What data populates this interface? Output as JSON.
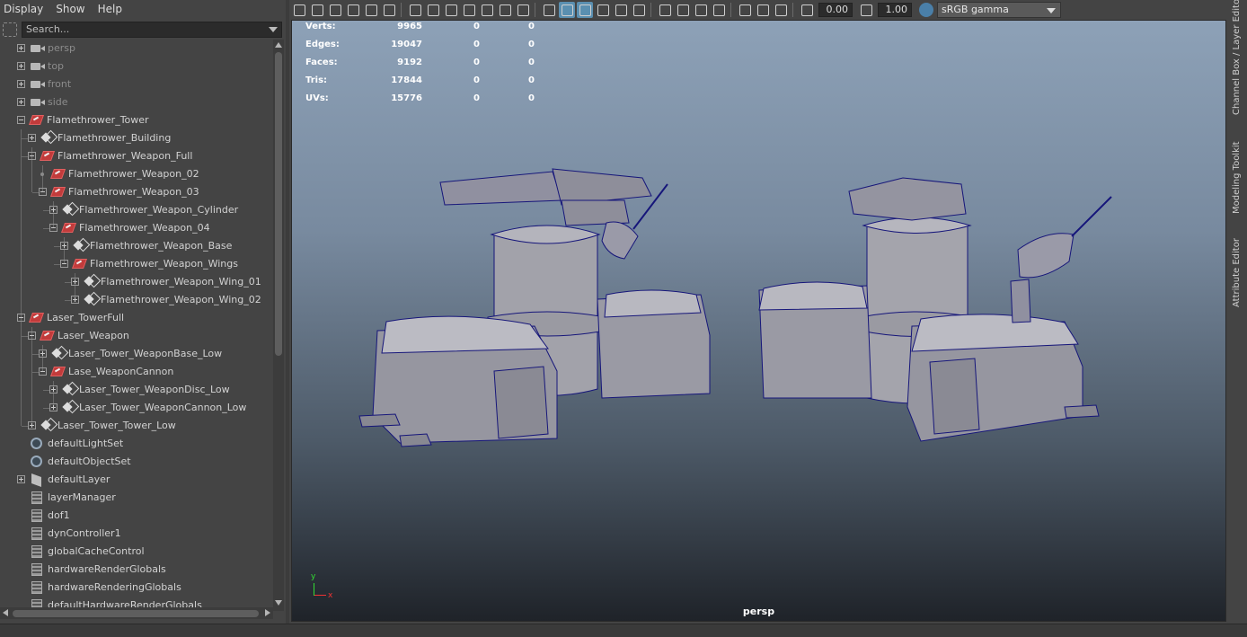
{
  "outliner": {
    "menu": [
      "Display",
      "Show",
      "Help"
    ],
    "search_placeholder": "Search...",
    "items": [
      {
        "label": "persp",
        "icon": "camera-icon",
        "dim": true
      },
      {
        "label": "top",
        "icon": "camera-icon",
        "dim": true
      },
      {
        "label": "front",
        "icon": "camera-icon",
        "dim": true
      },
      {
        "label": "side",
        "icon": "camera-icon",
        "dim": true
      },
      {
        "label": "Flamethrower_Tower",
        "icon": "group-icon"
      },
      {
        "label": "Flamethrower_Building",
        "icon": "mesh-icon"
      },
      {
        "label": "Flamethrower_Weapon_Full",
        "icon": "group-icon"
      },
      {
        "label": "Flamethrower_Weapon_02",
        "icon": "group-icon"
      },
      {
        "label": "Flamethrower_Weapon_03",
        "icon": "group-icon"
      },
      {
        "label": "Flamethrower_Weapon_Cylinder",
        "icon": "mesh-icon"
      },
      {
        "label": "Flamethrower_Weapon_04",
        "icon": "group-icon"
      },
      {
        "label": "Flamethrower_Weapon_Base",
        "icon": "mesh-icon"
      },
      {
        "label": "Flamethrower_Weapon_Wings",
        "icon": "group-icon"
      },
      {
        "label": "Flamethrower_Weapon_Wing_01",
        "icon": "mesh-icon"
      },
      {
        "label": "Flamethrower_Weapon_Wing_02",
        "icon": "mesh-icon"
      },
      {
        "label": "Laser_TowerFull",
        "icon": "group-icon"
      },
      {
        "label": "Laser_Weapon",
        "icon": "group-icon"
      },
      {
        "label": "Laser_Tower_WeaponBase_Low",
        "icon": "mesh-icon"
      },
      {
        "label": "Lase_WeaponCannon",
        "icon": "group-icon"
      },
      {
        "label": "Laser_Tower_WeaponDisc_Low",
        "icon": "mesh-icon"
      },
      {
        "label": "Laser_Tower_WeaponCannon_Low",
        "icon": "mesh-icon"
      },
      {
        "label": "Laser_Tower_Tower_Low",
        "icon": "mesh-icon"
      },
      {
        "label": "defaultLightSet",
        "icon": "set-icon"
      },
      {
        "label": "defaultObjectSet",
        "icon": "set-icon"
      },
      {
        "label": "defaultLayer",
        "icon": "layer-icon"
      },
      {
        "label": "layerManager",
        "icon": "node-icon"
      },
      {
        "label": "dof1",
        "icon": "node-icon"
      },
      {
        "label": "dynController1",
        "icon": "node-icon"
      },
      {
        "label": "globalCacheControl",
        "icon": "node-icon"
      },
      {
        "label": "hardwareRenderGlobals",
        "icon": "node-icon"
      },
      {
        "label": "hardwareRenderingGlobals",
        "icon": "node-icon"
      },
      {
        "label": "defaultHardwareRenderGlobals",
        "icon": "node-icon"
      }
    ]
  },
  "toolbar": {
    "exposure": "0.00",
    "gamma": "1.00",
    "color_space": "sRGB gamma"
  },
  "viewport": {
    "hud": [
      {
        "key": "Verts:",
        "a": "9965",
        "b": "0",
        "c": "0"
      },
      {
        "key": "Edges:",
        "a": "19047",
        "b": "0",
        "c": "0"
      },
      {
        "key": "Faces:",
        "a": "9192",
        "b": "0",
        "c": "0"
      },
      {
        "key": "Tris:",
        "a": "17844",
        "b": "0",
        "c": "0"
      },
      {
        "key": "UVs:",
        "a": "15776",
        "b": "0",
        "c": "0"
      }
    ],
    "camera": "persp",
    "axis_x": "x",
    "axis_y": "y"
  },
  "side_tabs": [
    "Channel Box / Layer Editor",
    "Modeling Toolkit",
    "Attribute Editor"
  ]
}
